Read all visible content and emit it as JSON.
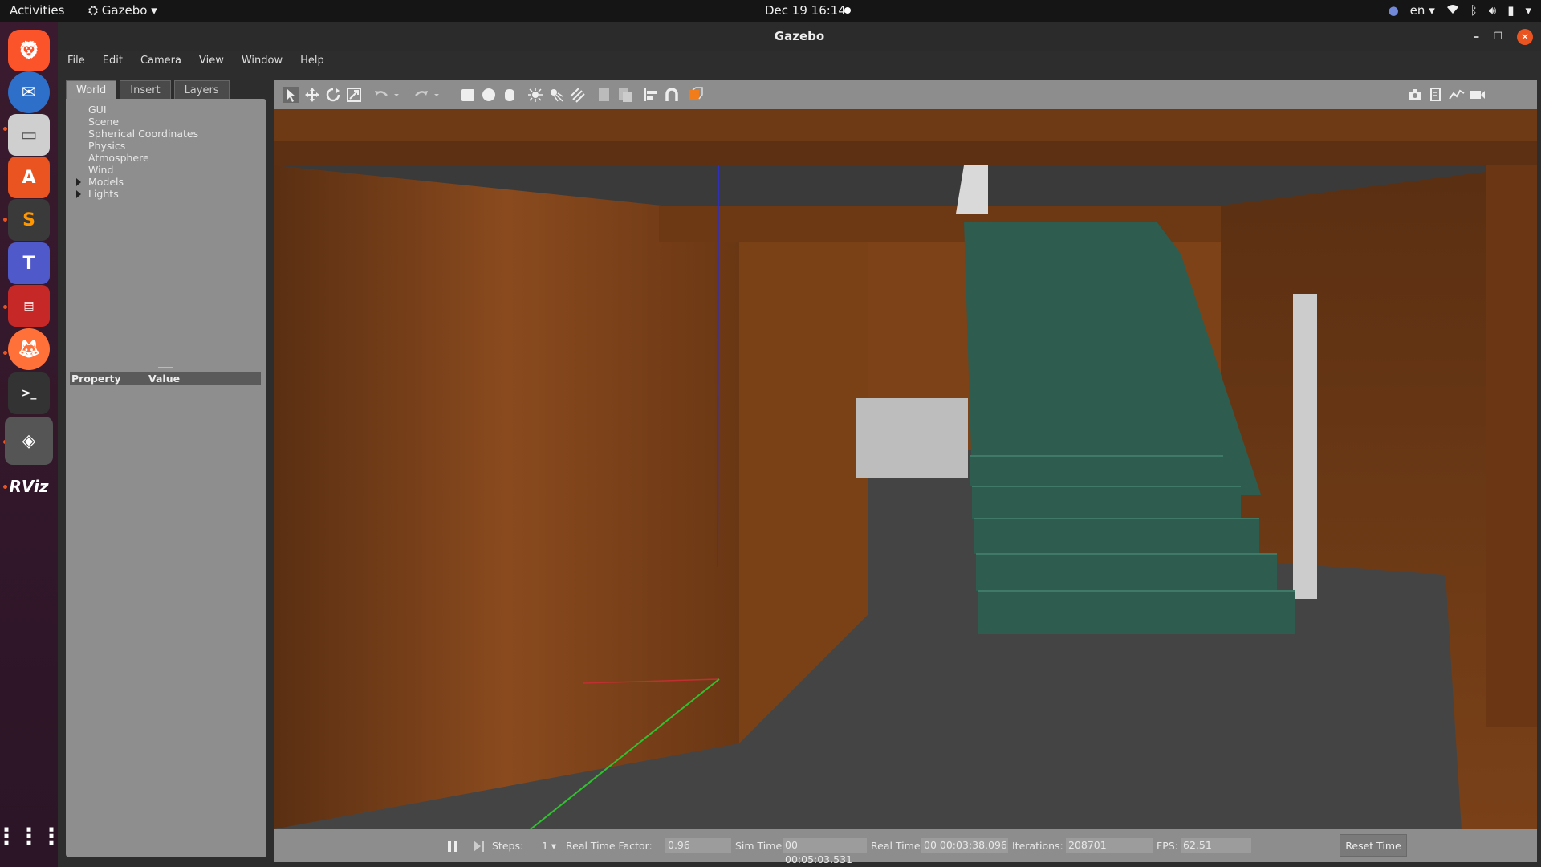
{
  "topbar": {
    "activities": "Activities",
    "app_menu": "Gazebo",
    "clock": "Dec 19  16:14",
    "lang": "en"
  },
  "dock": {
    "apps": [
      "brave-browser",
      "thunderbird",
      "files",
      "ubuntu-software",
      "sublime-text",
      "teams",
      "terminal-app",
      "firefox",
      "terminal",
      "gazebo",
      "rviz",
      "app-grid"
    ]
  },
  "window": {
    "title": "Gazebo"
  },
  "menu": {
    "items": [
      "File",
      "Edit",
      "Camera",
      "View",
      "Window",
      "Help"
    ]
  },
  "left_panel": {
    "tabs": [
      "World",
      "Insert",
      "Layers"
    ],
    "tree": [
      "GUI",
      "Scene",
      "Spherical Coordinates",
      "Physics",
      "Atmosphere",
      "Wind",
      "Models",
      "Lights"
    ],
    "property_header": "Property",
    "value_header": "Value"
  },
  "statusbar": {
    "steps_label": "Steps:",
    "steps_value": "1",
    "rtf_label": "Real Time Factor:",
    "rtf_value": "0.96",
    "sim_label": "Sim Time:",
    "sim_value": "00 00:05:03.531",
    "real_label": "Real Time:",
    "real_value": "00 00:03:38.096",
    "iter_label": "Iterations:",
    "iter_value": "208701",
    "fps_label": "FPS:",
    "fps_value": "62.51",
    "reset_label": "Reset Time"
  }
}
